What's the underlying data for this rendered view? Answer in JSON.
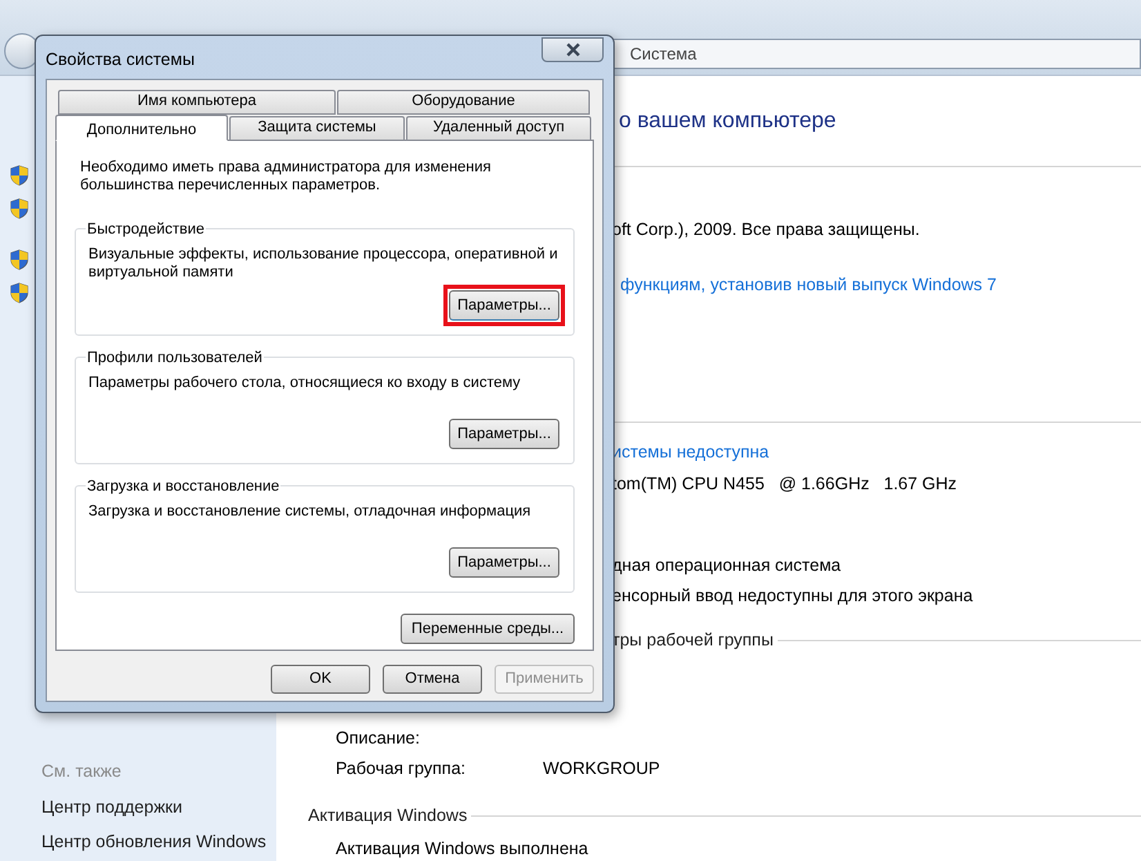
{
  "explorer": {
    "title": "Система",
    "right_rows": [
      {
        "kind": "title",
        "text": "о вашем компьютере"
      },
      {
        "kind": "text",
        "text": "oft Corp.), 2009. Все права защищены."
      },
      {
        "kind": "link",
        "text": "функциям, установив новый выпуск Windows 7"
      },
      {
        "kind": "link",
        "text": "истемы недоступна"
      },
      {
        "kind": "text",
        "text": "tom(TM) CPU N455   @ 1.66GHz   1.67 GHz"
      },
      {
        "kind": "text",
        "text": "дная операционная система"
      },
      {
        "kind": "text",
        "text": "енсорный ввод недоступны для этого экрана"
      },
      {
        "kind": "heading",
        "text": "тры рабочей группы"
      },
      {
        "kind": "field",
        "label": "Описание:"
      },
      {
        "kind": "field",
        "label": "Рабочая группа:",
        "value": "WORKGROUP"
      },
      {
        "kind": "heading",
        "text": "Активация Windows"
      },
      {
        "kind": "text",
        "text": "Активация Windows выполнена"
      }
    ],
    "see_also": {
      "title": "См. также",
      "links": [
        "Центр поддержки",
        "Центр обновления Windows"
      ]
    }
  },
  "dialog": {
    "title": "Свойства системы",
    "tab_rows": [
      [
        {
          "label": "Имя компьютера",
          "selected": false
        },
        {
          "label": "Оборудование",
          "selected": false
        }
      ],
      [
        {
          "label": "Дополнительно",
          "selected": true
        },
        {
          "label": "Защита системы",
          "selected": false
        },
        {
          "label": "Удаленный доступ",
          "selected": false
        }
      ]
    ],
    "notice": "Необходимо иметь права администратора для изменения большинства перечисленных параметров.",
    "groups": [
      {
        "title": "Быстродействие",
        "description": "Визуальные эффекты, использование процессора, оперативной и виртуальной памяти",
        "button": "Параметры...",
        "highlighted": true
      },
      {
        "title": "Профили пользователей",
        "description": "Параметры рабочего стола, относящиеся ко входу в систему",
        "button": "Параметры...",
        "highlighted": false
      },
      {
        "title": "Загрузка и восстановление",
        "description": "Загрузка и восстановление системы, отладочная информация",
        "button": "Параметры...",
        "highlighted": false
      }
    ],
    "env_button": "Переменные среды...",
    "buttons": [
      {
        "label": "OK",
        "disabled": false
      },
      {
        "label": "Отмена",
        "disabled": false
      },
      {
        "label": "Применить",
        "disabled": true
      }
    ]
  }
}
